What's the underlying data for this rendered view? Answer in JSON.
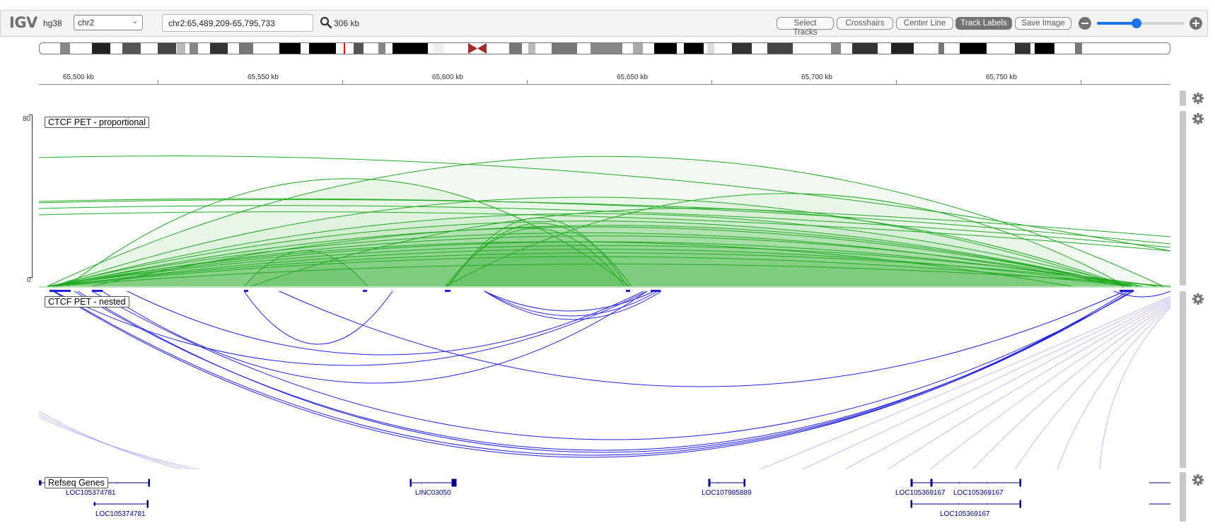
{
  "navbar": {
    "logo": "IGV",
    "genome": "hg38",
    "chromosome": "chr2",
    "locus": "chr2:65,489,209-65,795,733",
    "window_size": "306 kb",
    "buttons": {
      "select_tracks": "Select Tracks",
      "crosshairs": "Crosshairs",
      "center_line": "Center Line",
      "track_labels": "Track Labels",
      "save_image": "Save Image"
    },
    "zoom_level_fraction": 0.45
  },
  "ruler": {
    "ticks": [
      "65,500 kb",
      "65,550 kb",
      "65,600 kb",
      "65,650 kb",
      "65,700 kb",
      "65,750 kb"
    ]
  },
  "tracks": {
    "proportional": {
      "name": "CTCF PET - proportional",
      "scale_max": "80",
      "scale_min": "0"
    },
    "nested": {
      "name": "CTCF PET - nested"
    },
    "genes": {
      "name": "Refseq Genes",
      "labels": [
        "LOC105374781",
        "LOC105374781",
        "LINC03050",
        "LOC107985889",
        "LOC105369167",
        "LOC105369167",
        "LOC105369167"
      ]
    }
  },
  "colors": {
    "accent": "#1a73e8",
    "arc_green": "#22aa22",
    "arc_blue": "#2222dd",
    "gene_color": "#00008b",
    "cytoband_centromere": "#a52a2a"
  },
  "icons": [
    "igv-logo",
    "search-icon",
    "zoom-out-icon",
    "zoom-in-icon",
    "gear-icon",
    "chevron-down-icon"
  ]
}
